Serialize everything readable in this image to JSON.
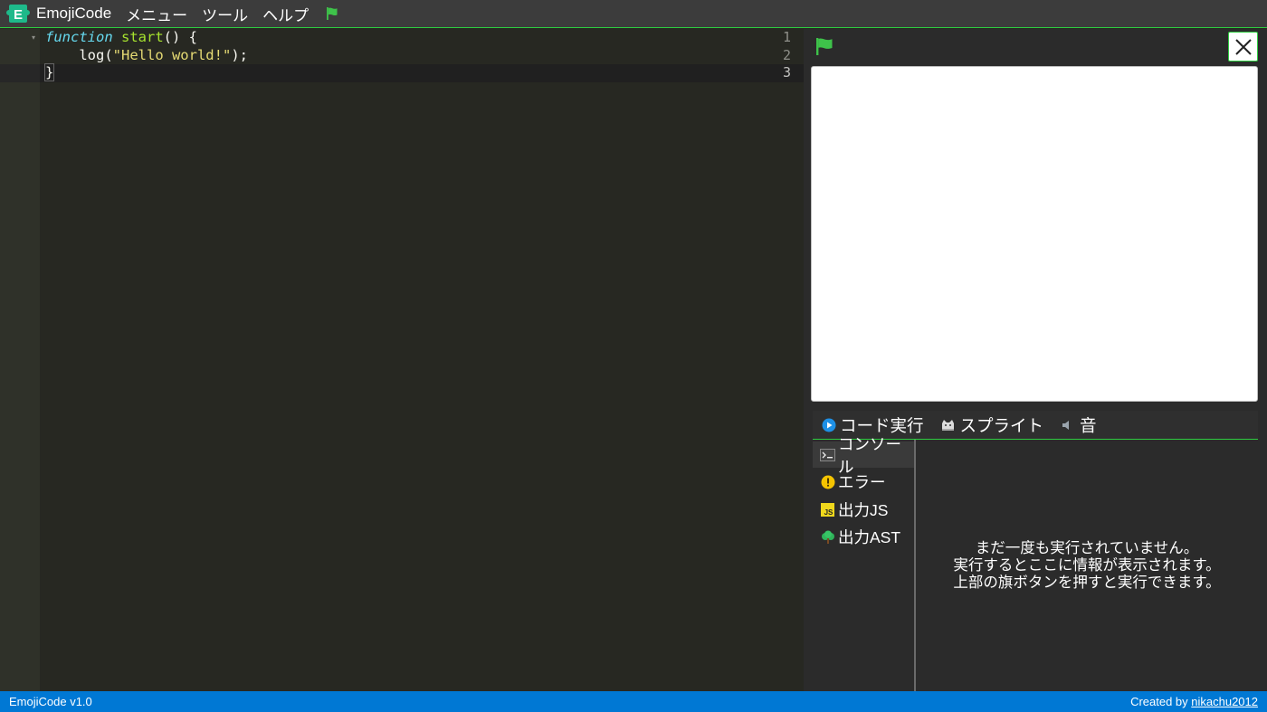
{
  "app": {
    "title": "EmojiCode",
    "logo_letter": "E"
  },
  "menu": {
    "items": [
      "メニュー",
      "ツール",
      "ヘルプ"
    ],
    "flag_icon": "green-flag-icon"
  },
  "editor": {
    "line_numbers": [
      "1",
      "2",
      "3"
    ],
    "lines": [
      {
        "keyword": "function",
        "space": " ",
        "name": "start",
        "rest": "() {"
      },
      {
        "indent": "    ",
        "call": "log(",
        "string": "\"Hello world!\"",
        "end": ");"
      },
      {
        "text": "}"
      }
    ]
  },
  "stage": {
    "run_flag_icon": "green-flag-icon",
    "close_icon": "close-icon"
  },
  "tabs": [
    {
      "icon": "play-circle-icon",
      "label": "コード実行"
    },
    {
      "icon": "sprite-icon",
      "label": "スプライト"
    },
    {
      "icon": "speaker-icon",
      "label": "音"
    }
  ],
  "sidenav": [
    {
      "icon": "terminal-icon",
      "label": "コンソール",
      "active": true
    },
    {
      "icon": "warning-icon",
      "label": "エラー"
    },
    {
      "icon": "js-icon",
      "label": "出力JS"
    },
    {
      "icon": "tree-icon",
      "label": "出力AST"
    }
  ],
  "console": {
    "lines": [
      "まだ一度も実行されていません。",
      "実行するとここに情報が表示されます。",
      "上部の旗ボタンを押すと実行できます。"
    ]
  },
  "status": {
    "version": "EmojiCode v1.0",
    "created_by": "Created by ",
    "author": "nikachu2012"
  },
  "colors": {
    "accent_green": "#2ecc40",
    "status_blue": "#0078d4",
    "editor_bg": "#272822"
  }
}
